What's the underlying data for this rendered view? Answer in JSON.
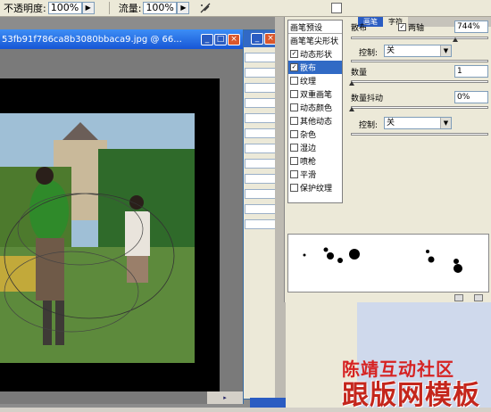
{
  "options": {
    "opacity_label": "不透明度:",
    "opacity_value": "100%",
    "flow_label": "流量:",
    "flow_value": "100%"
  },
  "document": {
    "title": "53fb91f786ca8b3080bbaca9.jpg @ 66..."
  },
  "brushes_panel": {
    "tab_brush": "画笔",
    "tab_char": "字符",
    "list_header": "画笔预设",
    "items": [
      {
        "label": "画笔笔尖形状",
        "checkbox": false,
        "checked": false,
        "selected": false
      },
      {
        "label": "动态形状",
        "checkbox": true,
        "checked": true,
        "selected": false
      },
      {
        "label": "散布",
        "checkbox": true,
        "checked": true,
        "selected": true
      },
      {
        "label": "纹理",
        "checkbox": true,
        "checked": false,
        "selected": false
      },
      {
        "label": "双重画笔",
        "checkbox": true,
        "checked": false,
        "selected": false
      },
      {
        "label": "动态颜色",
        "checkbox": true,
        "checked": false,
        "selected": false
      },
      {
        "label": "其他动态",
        "checkbox": true,
        "checked": false,
        "selected": false
      },
      {
        "label": "杂色",
        "checkbox": true,
        "checked": false,
        "selected": false
      },
      {
        "label": "湿边",
        "checkbox": true,
        "checked": false,
        "selected": false
      },
      {
        "label": "喷枪",
        "checkbox": true,
        "checked": false,
        "selected": false
      },
      {
        "label": "平滑",
        "checkbox": true,
        "checked": false,
        "selected": false
      },
      {
        "label": "保护纹理",
        "checkbox": true,
        "checked": false,
        "selected": false
      }
    ],
    "scatter_label": "散布",
    "both_axes_label": "两轴",
    "scatter_value": "744%",
    "control_label": "控制:",
    "control_value": "关",
    "count_label": "数量",
    "count_value": "1",
    "count_jitter_label": "数量抖动",
    "count_jitter_value": "0%",
    "control2_label": "控制:",
    "control2_value": "关"
  },
  "watermark": {
    "line1": "陈靖互动社区",
    "line2": "跟版网模板"
  }
}
